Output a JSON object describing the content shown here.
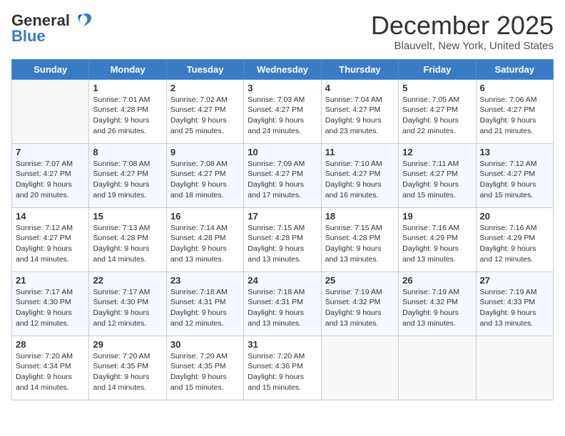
{
  "logo": {
    "text_general": "General",
    "text_blue": "Blue"
  },
  "title": "December 2025",
  "location": "Blauvelt, New York, United States",
  "days_of_week": [
    "Sunday",
    "Monday",
    "Tuesday",
    "Wednesday",
    "Thursday",
    "Friday",
    "Saturday"
  ],
  "weeks": [
    [
      {
        "day": "",
        "sunrise": "",
        "sunset": "",
        "daylight": ""
      },
      {
        "day": "1",
        "sunrise": "Sunrise: 7:01 AM",
        "sunset": "Sunset: 4:28 PM",
        "daylight": "Daylight: 9 hours and 26 minutes."
      },
      {
        "day": "2",
        "sunrise": "Sunrise: 7:02 AM",
        "sunset": "Sunset: 4:27 PM",
        "daylight": "Daylight: 9 hours and 25 minutes."
      },
      {
        "day": "3",
        "sunrise": "Sunrise: 7:03 AM",
        "sunset": "Sunset: 4:27 PM",
        "daylight": "Daylight: 9 hours and 24 minutes."
      },
      {
        "day": "4",
        "sunrise": "Sunrise: 7:04 AM",
        "sunset": "Sunset: 4:27 PM",
        "daylight": "Daylight: 9 hours and 23 minutes."
      },
      {
        "day": "5",
        "sunrise": "Sunrise: 7:05 AM",
        "sunset": "Sunset: 4:27 PM",
        "daylight": "Daylight: 9 hours and 22 minutes."
      },
      {
        "day": "6",
        "sunrise": "Sunrise: 7:06 AM",
        "sunset": "Sunset: 4:27 PM",
        "daylight": "Daylight: 9 hours and 21 minutes."
      }
    ],
    [
      {
        "day": "7",
        "sunrise": "Sunrise: 7:07 AM",
        "sunset": "Sunset: 4:27 PM",
        "daylight": "Daylight: 9 hours and 20 minutes."
      },
      {
        "day": "8",
        "sunrise": "Sunrise: 7:08 AM",
        "sunset": "Sunset: 4:27 PM",
        "daylight": "Daylight: 9 hours and 19 minutes."
      },
      {
        "day": "9",
        "sunrise": "Sunrise: 7:08 AM",
        "sunset": "Sunset: 4:27 PM",
        "daylight": "Daylight: 9 hours and 18 minutes."
      },
      {
        "day": "10",
        "sunrise": "Sunrise: 7:09 AM",
        "sunset": "Sunset: 4:27 PM",
        "daylight": "Daylight: 9 hours and 17 minutes."
      },
      {
        "day": "11",
        "sunrise": "Sunrise: 7:10 AM",
        "sunset": "Sunset: 4:27 PM",
        "daylight": "Daylight: 9 hours and 16 minutes."
      },
      {
        "day": "12",
        "sunrise": "Sunrise: 7:11 AM",
        "sunset": "Sunset: 4:27 PM",
        "daylight": "Daylight: 9 hours and 15 minutes."
      },
      {
        "day": "13",
        "sunrise": "Sunrise: 7:12 AM",
        "sunset": "Sunset: 4:27 PM",
        "daylight": "Daylight: 9 hours and 15 minutes."
      }
    ],
    [
      {
        "day": "14",
        "sunrise": "Sunrise: 7:12 AM",
        "sunset": "Sunset: 4:27 PM",
        "daylight": "Daylight: 9 hours and 14 minutes."
      },
      {
        "day": "15",
        "sunrise": "Sunrise: 7:13 AM",
        "sunset": "Sunset: 4:28 PM",
        "daylight": "Daylight: 9 hours and 14 minutes."
      },
      {
        "day": "16",
        "sunrise": "Sunrise: 7:14 AM",
        "sunset": "Sunset: 4:28 PM",
        "daylight": "Daylight: 9 hours and 13 minutes."
      },
      {
        "day": "17",
        "sunrise": "Sunrise: 7:15 AM",
        "sunset": "Sunset: 4:28 PM",
        "daylight": "Daylight: 9 hours and 13 minutes."
      },
      {
        "day": "18",
        "sunrise": "Sunrise: 7:15 AM",
        "sunset": "Sunset: 4:28 PM",
        "daylight": "Daylight: 9 hours and 13 minutes."
      },
      {
        "day": "19",
        "sunrise": "Sunrise: 7:16 AM",
        "sunset": "Sunset: 4:29 PM",
        "daylight": "Daylight: 9 hours and 13 minutes."
      },
      {
        "day": "20",
        "sunrise": "Sunrise: 7:16 AM",
        "sunset": "Sunset: 4:29 PM",
        "daylight": "Daylight: 9 hours and 12 minutes."
      }
    ],
    [
      {
        "day": "21",
        "sunrise": "Sunrise: 7:17 AM",
        "sunset": "Sunset: 4:30 PM",
        "daylight": "Daylight: 9 hours and 12 minutes."
      },
      {
        "day": "22",
        "sunrise": "Sunrise: 7:17 AM",
        "sunset": "Sunset: 4:30 PM",
        "daylight": "Daylight: 9 hours and 12 minutes."
      },
      {
        "day": "23",
        "sunrise": "Sunrise: 7:18 AM",
        "sunset": "Sunset: 4:31 PM",
        "daylight": "Daylight: 9 hours and 12 minutes."
      },
      {
        "day": "24",
        "sunrise": "Sunrise: 7:18 AM",
        "sunset": "Sunset: 4:31 PM",
        "daylight": "Daylight: 9 hours and 13 minutes."
      },
      {
        "day": "25",
        "sunrise": "Sunrise: 7:19 AM",
        "sunset": "Sunset: 4:32 PM",
        "daylight": "Daylight: 9 hours and 13 minutes."
      },
      {
        "day": "26",
        "sunrise": "Sunrise: 7:19 AM",
        "sunset": "Sunset: 4:32 PM",
        "daylight": "Daylight: 9 hours and 13 minutes."
      },
      {
        "day": "27",
        "sunrise": "Sunrise: 7:19 AM",
        "sunset": "Sunset: 4:33 PM",
        "daylight": "Daylight: 9 hours and 13 minutes."
      }
    ],
    [
      {
        "day": "28",
        "sunrise": "Sunrise: 7:20 AM",
        "sunset": "Sunset: 4:34 PM",
        "daylight": "Daylight: 9 hours and 14 minutes."
      },
      {
        "day": "29",
        "sunrise": "Sunrise: 7:20 AM",
        "sunset": "Sunset: 4:35 PM",
        "daylight": "Daylight: 9 hours and 14 minutes."
      },
      {
        "day": "30",
        "sunrise": "Sunrise: 7:20 AM",
        "sunset": "Sunset: 4:35 PM",
        "daylight": "Daylight: 9 hours and 15 minutes."
      },
      {
        "day": "31",
        "sunrise": "Sunrise: 7:20 AM",
        "sunset": "Sunset: 4:36 PM",
        "daylight": "Daylight: 9 hours and 15 minutes."
      },
      {
        "day": "",
        "sunrise": "",
        "sunset": "",
        "daylight": ""
      },
      {
        "day": "",
        "sunrise": "",
        "sunset": "",
        "daylight": ""
      },
      {
        "day": "",
        "sunrise": "",
        "sunset": "",
        "daylight": ""
      }
    ]
  ]
}
